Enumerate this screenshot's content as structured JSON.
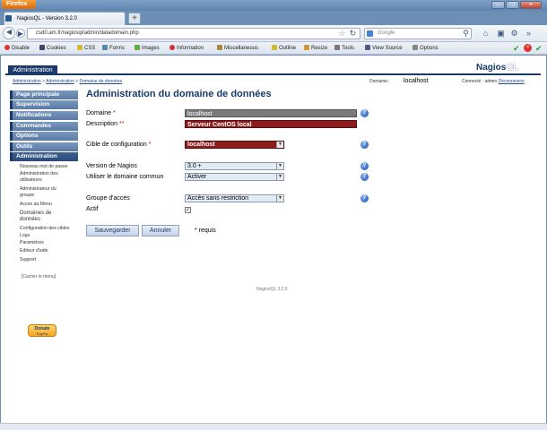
{
  "browser": {
    "app_button": "Firefox",
    "tab_title": "NagiosQL - Version 3.2.0",
    "new_tab": "+",
    "url": "csd0.am.fr/nagiosql/admin/datadomain.php",
    "search_placeholder": "Google",
    "toolbar_items": [
      "Disable",
      "Cookies",
      "CSS",
      "Forms",
      "Images",
      "Information",
      "Miscellaneous",
      "Outline",
      "Resize",
      "Tools",
      "View Source",
      "Options"
    ]
  },
  "header": {
    "tab": "Administration",
    "logo_main": "Nagios",
    "logo_accent": "QL"
  },
  "breadcrumb": {
    "a": "Administration",
    "b": "Administration",
    "c": "Domaine de données",
    "sep": ">"
  },
  "domain_select": {
    "label": "Domaine:",
    "value": "localhost"
  },
  "user": {
    "prefix": "Connecté : admin",
    "logout": "Déconnexion"
  },
  "sidebar": {
    "sections": [
      "Page principale",
      "Supervision",
      "Notifications",
      "Commandes",
      "Options",
      "Outils",
      "Administration"
    ],
    "sub_items": [
      "Nouveau mot de passe",
      "Administration des utilisateurs",
      "Administrateur du groupe",
      "Accès au Menu",
      "Domaines de données",
      "Configuration des cibles",
      "Logs",
      "Paramètres",
      "Editeur d'aide",
      "Support"
    ],
    "hide_menu": "[Cacher le menu]",
    "donate": "Donate",
    "donate_sub": "PayPal"
  },
  "form": {
    "title": "Administration du domaine de données",
    "domain_label": "Domaine",
    "domain_value": "localhost",
    "description_label": "Description",
    "description_value": "Serveur CentOS local",
    "target_label": "Cible de configuration",
    "target_value": "localhost",
    "nagios_label": "Version de Nagios",
    "nagios_value": "3.0 +",
    "common_label": "Utiliser le domaine commun",
    "common_value": "Activer",
    "group_label": "Groupe d'accès",
    "group_value": "Accès sans restriction",
    "active_label": "Actif",
    "req_star": "*",
    "req_dstar": "**",
    "save": "Sauvegarder",
    "cancel": "Annuler",
    "required_note": "* requis",
    "help": "?"
  },
  "footer": "NagiosQL 3.2.0"
}
